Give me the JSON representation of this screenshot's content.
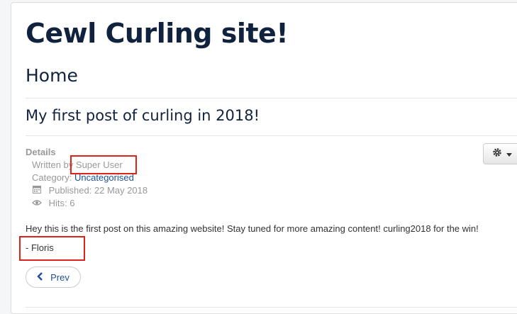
{
  "site": {
    "title": "Cewl Curling site!"
  },
  "page": {
    "heading": "Home"
  },
  "article": {
    "title": "My first post of curling in 2018!",
    "details_label": "Details",
    "written_by_prefix": "Written by",
    "author": "Super User",
    "category_prefix": "Category:",
    "category": "Uncategorised",
    "published": "Published: 22 May 2018",
    "hits": "Hits: 6",
    "body": "Hey this is the first post on this amazing website! Stay tuned for more amazing content! curling2018 for the win!",
    "signature": "- Floris"
  },
  "nav": {
    "prev_label": "Prev"
  },
  "icons": {
    "calendar": "calendar-icon",
    "eye": "eye-icon",
    "gear": "gear-icon",
    "caret": "caret-down-icon",
    "chevron": "chevron-left-icon"
  },
  "colors": {
    "heading": "#10223e",
    "link": "#1f4e9e",
    "highlight": "#e0231a"
  }
}
